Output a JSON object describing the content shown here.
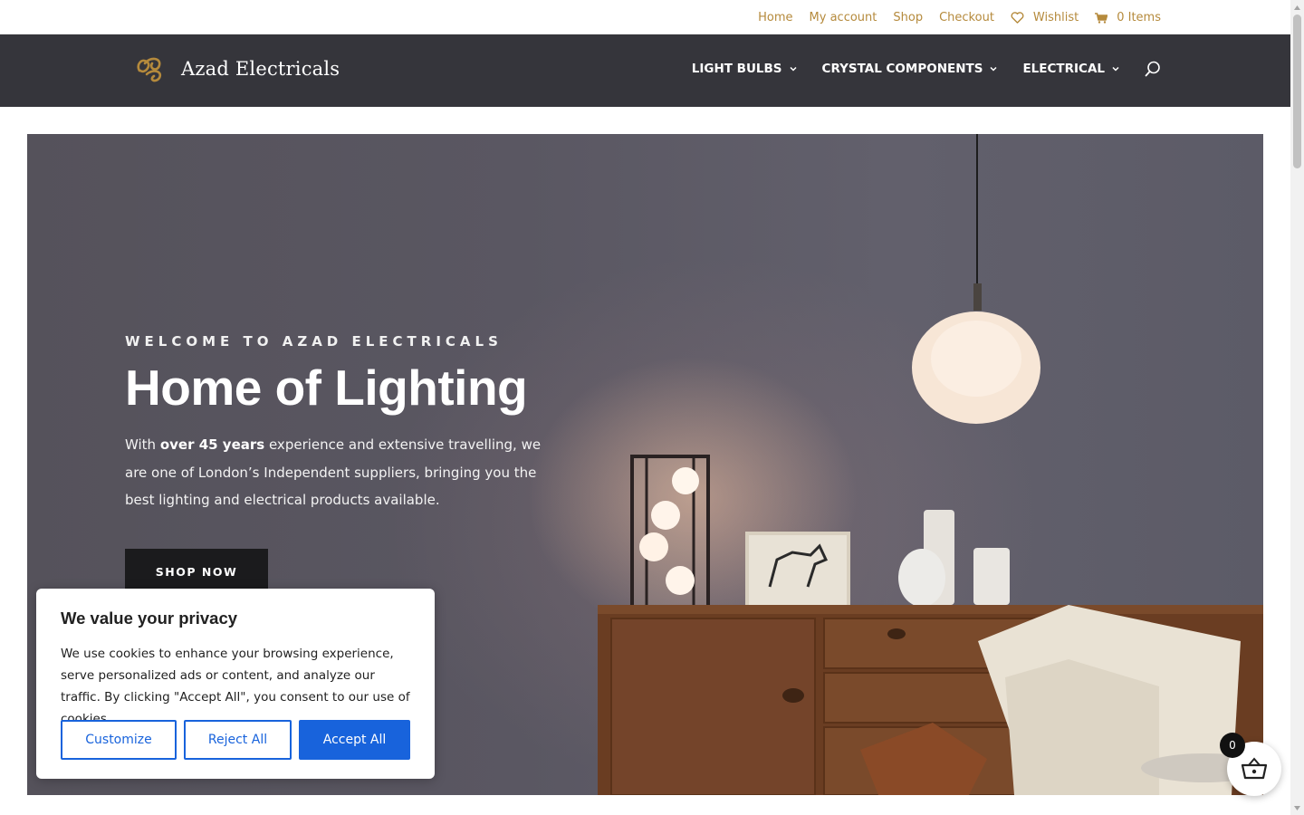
{
  "topbar": {
    "links": [
      "Home",
      "My account",
      "Shop",
      "Checkout"
    ],
    "wishlist_label": "Wishlist",
    "cart_label": "0 Items"
  },
  "header": {
    "logo_text": "Azad Electricals",
    "nav": [
      "LIGHT BULBS",
      "CRYSTAL COMPONENTS",
      "ELECTRICAL"
    ]
  },
  "hero": {
    "eyebrow": "WELCOME TO AZAD ELECTRICALS",
    "title": "Home of Lighting",
    "desc_pre": "With ",
    "desc_bold": "over 45 years",
    "desc_post": " experience and extensive travelling, we are one of London’s Independent suppliers, bringing you the best lighting and electrical products available.",
    "cta": "SHOP NOW"
  },
  "cookie": {
    "title": "We value your privacy",
    "text": "We use cookies to enhance your browsing experience, serve personalized ads or content, and analyze our traffic. By clicking \"Accept All\", you consent to our use of cookies.",
    "customize": "Customize",
    "reject": "Reject All",
    "accept": "Accept All"
  },
  "cart_float": {
    "count": "0"
  },
  "colors": {
    "accent_gold": "#b58a3c",
    "header_bg": "#35353b",
    "cookie_blue": "#1863dc"
  }
}
